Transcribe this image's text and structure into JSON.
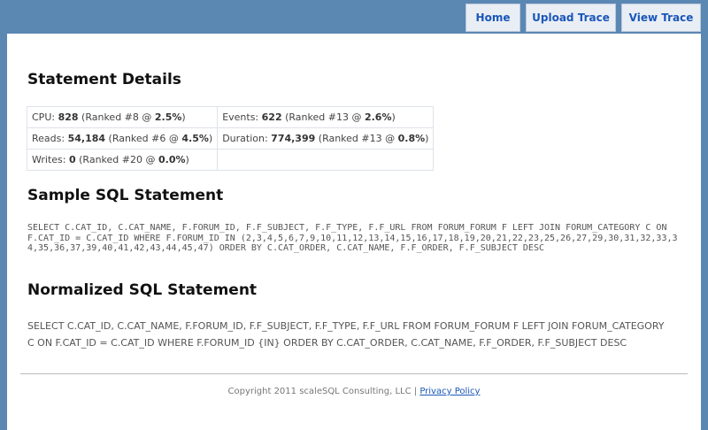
{
  "nav": {
    "home": "Home",
    "upload_trace": "Upload Trace",
    "view_trace": "View Trace"
  },
  "statement_details": {
    "title": "Statement Details",
    "rows": [
      [
        {
          "label": "CPU:",
          "value": "828",
          "rank_text": "(Ranked #8 @",
          "pct": "2.5%",
          "close": ")"
        },
        {
          "label": "Events:",
          "value": "622",
          "rank_text": "(Ranked #13 @",
          "pct": "2.6%",
          "close": ")"
        }
      ],
      [
        {
          "label": "Reads:",
          "value": "54,184",
          "rank_text": "(Ranked #6 @",
          "pct": "4.5%",
          "close": ")"
        },
        {
          "label": "Duration:",
          "value": "774,399",
          "rank_text": "(Ranked #13 @",
          "pct": "0.8%",
          "close": ")"
        }
      ],
      [
        {
          "label": "Writes:",
          "value": "0",
          "rank_text": "(Ranked #20 @",
          "pct": "0.0%",
          "close": ")"
        }
      ]
    ]
  },
  "sample_sql": {
    "title": "Sample SQL Statement",
    "text": "SELECT C.CAT_ID, C.CAT_NAME, F.FORUM_ID, F.F_SUBJECT, F.F_TYPE, F.F_URL FROM FORUM_FORUM F LEFT JOIN FORUM_CATEGORY C ON F.CAT_ID = C.CAT_ID WHERE F.FORUM_ID IN (2,3,4,5,6,7,9,10,11,12,13,14,15,16,17,18,19,20,21,22,23,25,26,27,29,30,31,32,33,34,35,36,37,39,40,41,42,43,44,45,47) ORDER BY C.CAT_ORDER, C.CAT_NAME, F.F_ORDER, F.F_SUBJECT DESC"
  },
  "normalized_sql": {
    "title": "Normalized SQL Statement",
    "text": "SELECT C.CAT_ID, C.CAT_NAME, F.FORUM_ID, F.F_SUBJECT, F.F_TYPE, F.F_URL FROM FORUM_FORUM F LEFT JOIN FORUM_CATEGORY C ON F.CAT_ID = C.CAT_ID WHERE F.FORUM_ID {IN} ORDER BY C.CAT_ORDER, C.CAT_NAME, F.F_ORDER, F.F_SUBJECT DESC"
  },
  "footer": {
    "copyright": "Copyright 2011 scaleSQL Consulting, LLC |",
    "privacy_link": "Privacy Policy"
  },
  "colors": {
    "background": "#5b87b3",
    "link": "#1a56b8"
  }
}
